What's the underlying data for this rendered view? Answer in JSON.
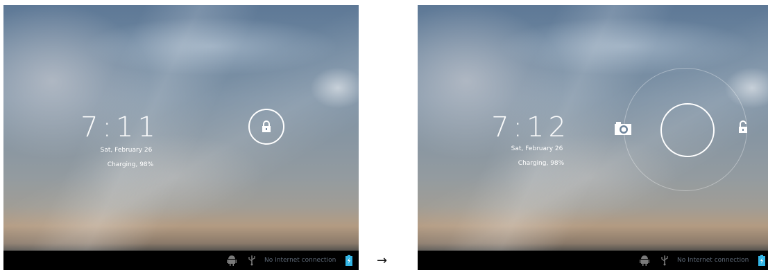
{
  "transition_arrow": "→",
  "screens": {
    "before": {
      "time": "7:11",
      "date": "Sat, February 26",
      "charging": "Charging, 98%",
      "status_text": "No Internet connection",
      "lock_icon": "lock-icon"
    },
    "after": {
      "time": "7:12",
      "date": "Sat, February 26",
      "charging": "Charging, 98%",
      "status_text": "No Internet connection",
      "camera_icon": "camera-icon",
      "unlock_icon": "unlock-icon"
    }
  },
  "icons": {
    "navbar": [
      "android-debug-icon",
      "usb-icon",
      "battery-icon"
    ]
  },
  "colors": {
    "navbar": "#000000",
    "text": "#ffffff",
    "status_text": "#5f6a78",
    "battery": "#33b5e5"
  }
}
